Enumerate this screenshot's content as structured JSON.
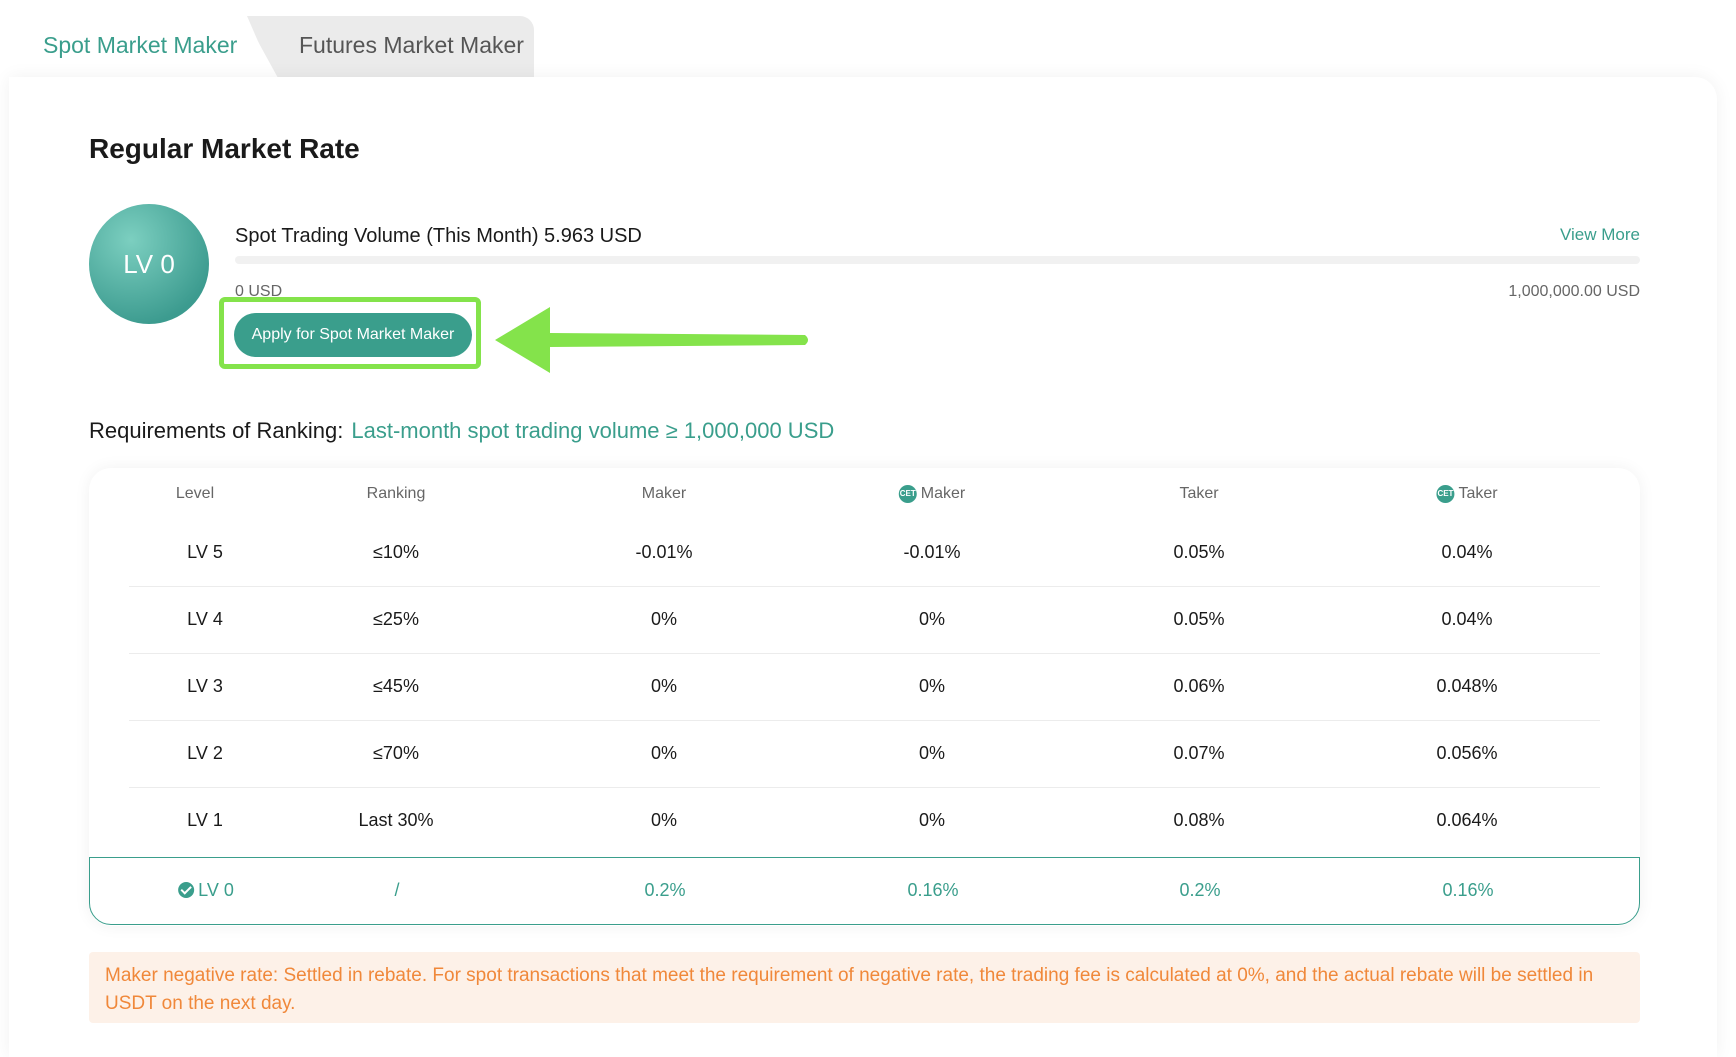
{
  "tabs": [
    {
      "label": "Spot Market Maker",
      "active": true
    },
    {
      "label": "Futures Market Maker",
      "active": false
    }
  ],
  "page": {
    "title": "Regular Market Rate"
  },
  "level": {
    "current": "LV 0"
  },
  "volume": {
    "label": "Spot Trading Volume (This Month) 5.963 USD",
    "view_more": "View More",
    "min_label": "0 USD",
    "max_label": "1,000,000.00 USD",
    "progress_fraction": 6e-06
  },
  "apply_button": {
    "label": "Apply for Spot Market Maker"
  },
  "requirements": {
    "label": "Requirements of Ranking:",
    "value": "Last-month spot trading volume ≥ 1,000,000 USD"
  },
  "table": {
    "headers": {
      "level": "Level",
      "ranking": "Ranking",
      "maker": "Maker",
      "cet_maker": "Maker",
      "taker": "Taker",
      "cet_taker": "Taker",
      "cet_icon_text": "CET"
    },
    "rows": [
      {
        "level": "LV 5",
        "ranking": "≤10%",
        "maker": "-0.01%",
        "cet_maker": "-0.01%",
        "taker": "0.05%",
        "cet_taker": "0.04%"
      },
      {
        "level": "LV 4",
        "ranking": "≤25%",
        "maker": "0%",
        "cet_maker": "0%",
        "taker": "0.05%",
        "cet_taker": "0.04%"
      },
      {
        "level": "LV 3",
        "ranking": "≤45%",
        "maker": "0%",
        "cet_maker": "0%",
        "taker": "0.06%",
        "cet_taker": "0.048%"
      },
      {
        "level": "LV 2",
        "ranking": "≤70%",
        "maker": "0%",
        "cet_maker": "0%",
        "taker": "0.07%",
        "cet_taker": "0.056%"
      },
      {
        "level": "LV 1",
        "ranking": "Last 30%",
        "maker": "0%",
        "cet_maker": "0%",
        "taker": "0.08%",
        "cet_taker": "0.064%"
      }
    ],
    "current_row": {
      "level": "LV 0",
      "ranking": "/",
      "maker": "0.2%",
      "cet_maker": "0.16%",
      "taker": "0.2%",
      "cet_taker": "0.16%"
    }
  },
  "notice": {
    "text": "Maker negative rate: Settled in rebate. For spot transactions that meet the requirement of negative rate, the trading fee is calculated at 0%, and the actual rebate will be settled in USDT on the next day."
  },
  "colors": {
    "accent": "#3a9e8c",
    "highlight": "#84e34b",
    "notice_text": "#f0883a",
    "notice_bg": "#fdf1e8"
  }
}
